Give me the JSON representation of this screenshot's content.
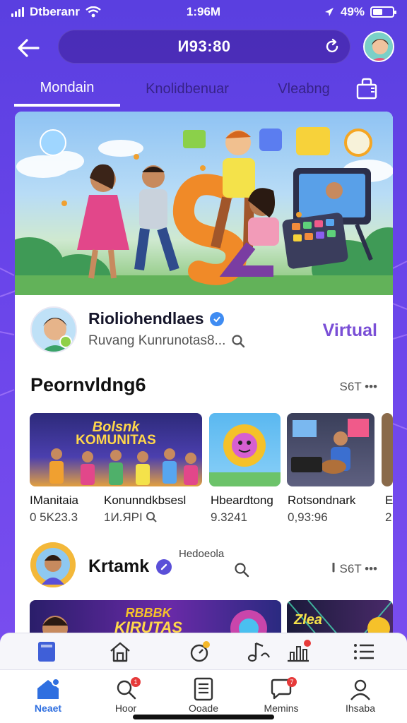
{
  "status_bar": {
    "carrier": "Dtberanr",
    "time": "1:96M",
    "battery_text": "49%",
    "battery_level": 0.49
  },
  "top_bar": {
    "url_text": "И93:80"
  },
  "tabs": [
    {
      "label": "Mondain"
    },
    {
      "label": "Knolidbenuar"
    },
    {
      "label": "Vleabng"
    }
  ],
  "profile": {
    "name": "Rioliohendlaes",
    "subtitle": "Ruvang Kunrunotas8...",
    "action": "Virtual"
  },
  "section": {
    "title": "Peornvldng6",
    "more": "S6T •••"
  },
  "thumbnails": [
    {
      "title": "IManitaia",
      "meta": "0 5K23.3",
      "overlay_line1": "Bolsnk",
      "overlay_line2": "KOMUNITAS"
    },
    {
      "title": "Konunndkbsesl",
      "meta": "1И.ЯPI"
    },
    {
      "title": "Hbeardtong",
      "meta": "9.3241"
    },
    {
      "title": "Rotsondnark",
      "meta": "0,93:96"
    },
    {
      "title": "E",
      "meta": "2"
    }
  ],
  "second_creator": {
    "name": "Krtamk",
    "tag": "Hedoeola",
    "more": "S6T •••"
  },
  "banners": [
    {
      "line1": "RBBBK",
      "line2": "KIRUTAS"
    },
    {
      "line1": "Zlea"
    }
  ],
  "bottom_nav": [
    {
      "label": "Neaet",
      "active": true
    },
    {
      "label": "Hoor",
      "badge": "1"
    },
    {
      "label": "Ooade"
    },
    {
      "label": "Memins",
      "badge": "7"
    },
    {
      "label": "Ihsaba"
    }
  ],
  "colors": {
    "background": "#6a45ea",
    "accent_purple": "#7a4fd6",
    "verified_blue": "#3f8cf2",
    "active_nav": "#2f6fe0",
    "badge_red": "#e63a3a"
  }
}
